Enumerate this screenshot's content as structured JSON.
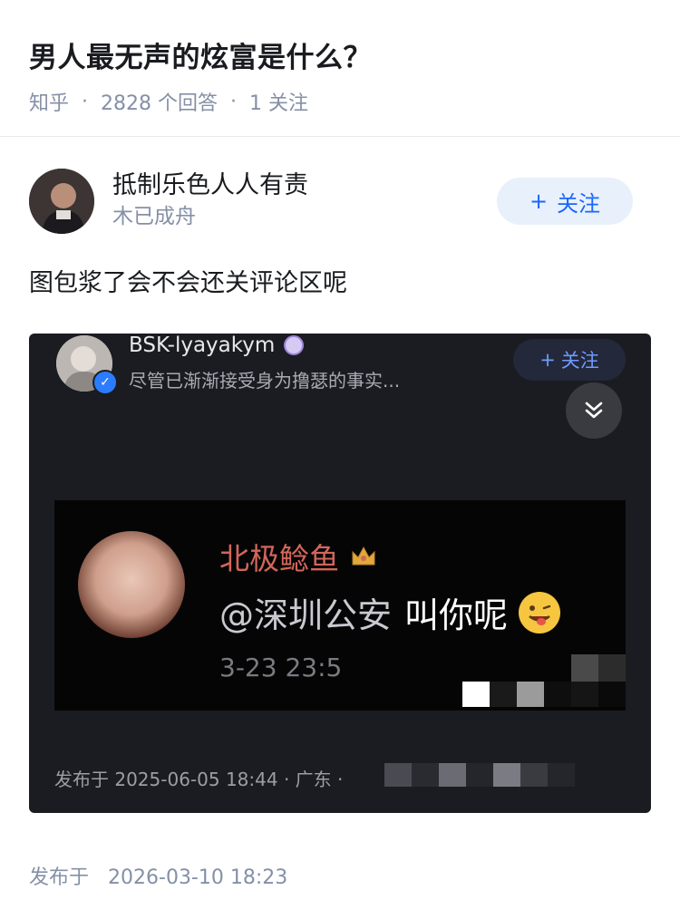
{
  "question": {
    "title": "男人最无声的炫富是什么？",
    "source": "知乎",
    "answers": "2828 个回答",
    "follows": "1 关注"
  },
  "answer": {
    "author_name": "抵制乐色人人有责",
    "author_bio": "木已成舟",
    "follow_label": "关注",
    "text": "图包浆了会不会还关评论区呢",
    "posted_label": "发布于",
    "posted_time": "2026-03-10 18:23"
  },
  "embedded": {
    "user_name": "BSK-lyayakym",
    "description": "尽管已渐渐接受身为撸瑟的事实...",
    "follow_label": "关注",
    "video": {
      "commenter": "北极鲶鱼",
      "mention": "@深圳公安",
      "message": "叫你呢",
      "time": "3-23 23:5"
    },
    "footer": "发布于 2025-06-05 18:44 · 广东 ·"
  },
  "icons": [
    "plus-icon",
    "expand-chevrons-icon",
    "verified-icon",
    "crown-icon",
    "emoji-icon",
    "badge-icon"
  ],
  "colors": {
    "accent": "#1a66ff",
    "follow_bg": "#e8f0fb",
    "meta": "#8590a6",
    "dark_card": "#1b1c22",
    "red_name": "#d2665a"
  }
}
